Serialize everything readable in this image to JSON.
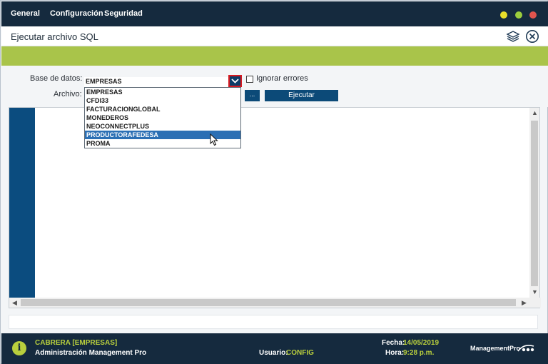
{
  "menu": {
    "items": [
      {
        "label": "General"
      },
      {
        "label": "Configuración"
      },
      {
        "label": "Seguridad"
      }
    ],
    "window_dots": [
      "#e8de2a",
      "#9ccd3d",
      "#e0544e"
    ]
  },
  "titlebar": {
    "title": "Ejecutar archivo SQL",
    "icons": [
      "layers-icon",
      "close-circle-icon"
    ]
  },
  "form": {
    "database_label": "Base de datos:",
    "database_value": "EMPRESAS",
    "ignore_errors_label": "Ignorar errores",
    "ignore_errors_checked": false,
    "file_label": "Archivo:",
    "browse_label": "...",
    "execute_label": "Ejecutar"
  },
  "dropdown": {
    "options": [
      "EMPRESAS",
      "CFDI33",
      "FACTURACIONGLOBAL",
      "MONEDEROS",
      "NEOCONNECTPLUS",
      "PRODUCTORAFEDESA",
      "PROMA"
    ],
    "highlighted": "PRODUCTORAFEDESA"
  },
  "footer": {
    "company": "CABRERA [EMPRESAS]",
    "app_name": "Administración Management Pro",
    "user_label": "Usuario:",
    "user_value": "CONFIG",
    "date_label": "Fecha:",
    "date_value": "14/05/2019",
    "time_label": "Hora:",
    "time_value": "9:28 p.m.",
    "brand": "ManagementPro"
  },
  "colors": {
    "menubar": "#152a3e",
    "accent_green": "#a9c44a",
    "button_blue": "#0c4a78",
    "gutter_blue": "#0b4c7f",
    "selection": "#2b6fb4",
    "footer_highlight": "#b9cf3d"
  }
}
